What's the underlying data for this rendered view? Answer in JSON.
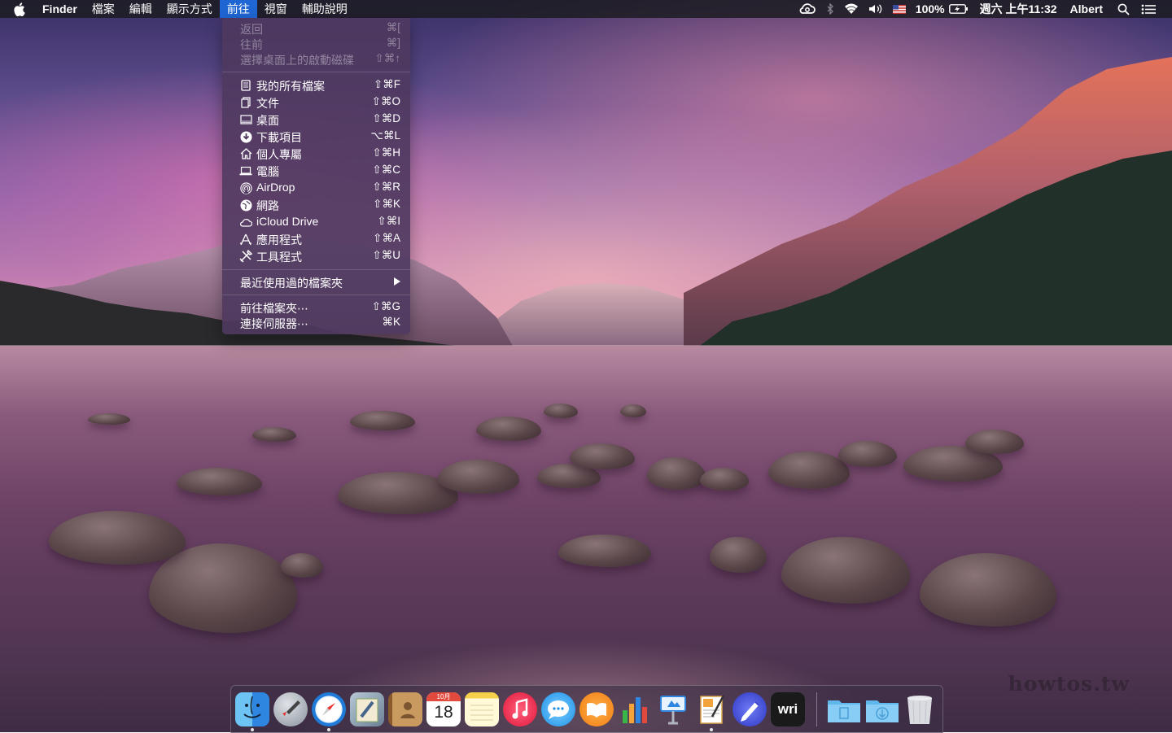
{
  "menubar": {
    "apple_icon": "apple-icon",
    "app_name": "Finder",
    "menus": [
      "檔案",
      "編輯",
      "顯示方式",
      "前往",
      "視窗",
      "輔助說明"
    ],
    "active_menu": "前往",
    "status": {
      "battery_percent": "100%",
      "clock": "週六 上午11:32",
      "user": "Albert",
      "icons": [
        "creative-cloud-icon",
        "bluetooth-icon",
        "wifi-icon",
        "volume-icon",
        "us-flag-icon",
        "battery-charging-icon",
        "spotlight-search-icon",
        "notification-center-icon"
      ]
    }
  },
  "go_menu": {
    "history": [
      {
        "label": "返回",
        "shortcut": "⌘[",
        "enabled": false
      },
      {
        "label": "往前",
        "shortcut": "⌘]",
        "enabled": false
      },
      {
        "label": "選擇桌面上的啟動磁碟",
        "shortcut": "⇧⌘↑",
        "enabled": false
      }
    ],
    "places": [
      {
        "label": "我的所有檔案",
        "shortcut": "⇧⌘F",
        "icon": "all-my-files-icon"
      },
      {
        "label": "文件",
        "shortcut": "⇧⌘O",
        "icon": "documents-icon"
      },
      {
        "label": "桌面",
        "shortcut": "⇧⌘D",
        "icon": "desktop-icon"
      },
      {
        "label": "下載項目",
        "shortcut": "⌥⌘L",
        "icon": "downloads-icon"
      },
      {
        "label": "個人專屬",
        "shortcut": "⇧⌘H",
        "icon": "home-icon"
      },
      {
        "label": "電腦",
        "shortcut": "⇧⌘C",
        "icon": "computer-icon"
      },
      {
        "label": "AirDrop",
        "shortcut": "⇧⌘R",
        "icon": "airdrop-icon"
      },
      {
        "label": "網路",
        "shortcut": "⇧⌘K",
        "icon": "network-icon"
      },
      {
        "label": "iCloud Drive",
        "shortcut": "⇧⌘I",
        "icon": "icloud-icon"
      },
      {
        "label": "應用程式",
        "shortcut": "⇧⌘A",
        "icon": "applications-icon"
      },
      {
        "label": "工具程式",
        "shortcut": "⇧⌘U",
        "icon": "utilities-icon"
      }
    ],
    "recent_folders": {
      "label": "最近使用過的檔案夾"
    },
    "footer": [
      {
        "label": "前往檔案夾⋯",
        "shortcut": "⇧⌘G"
      },
      {
        "label": "連接伺服器⋯",
        "shortcut": "⌘K"
      }
    ]
  },
  "dock": {
    "apps": [
      {
        "name": "finder-icon",
        "running": true
      },
      {
        "name": "launchpad-icon",
        "running": false
      },
      {
        "name": "safari-icon",
        "running": true
      },
      {
        "name": "mail-icon",
        "running": false
      },
      {
        "name": "contacts-icon",
        "running": false
      },
      {
        "name": "calendar-icon",
        "running": false,
        "month": "10月",
        "day": "18"
      },
      {
        "name": "notes-icon",
        "running": false
      },
      {
        "name": "itunes-icon",
        "running": false
      },
      {
        "name": "messages-icon",
        "running": false
      },
      {
        "name": "ibooks-icon",
        "running": false
      },
      {
        "name": "numbers-icon",
        "running": false
      },
      {
        "name": "keynote-icon",
        "running": false
      },
      {
        "name": "pages-icon",
        "running": true
      },
      {
        "name": "pixelmator-icon",
        "running": false
      },
      {
        "name": "writer-icon",
        "running": false,
        "text": "wri"
      }
    ],
    "folders": [
      {
        "name": "documents-folder-icon"
      },
      {
        "name": "downloads-folder-icon"
      },
      {
        "name": "trash-icon"
      }
    ]
  },
  "watermark": "howtos.tw",
  "colors": {
    "menu_highlight": "#1f66d4",
    "menubar_bg": "#1c1c22",
    "dropdown_bg": "#4e385e"
  }
}
